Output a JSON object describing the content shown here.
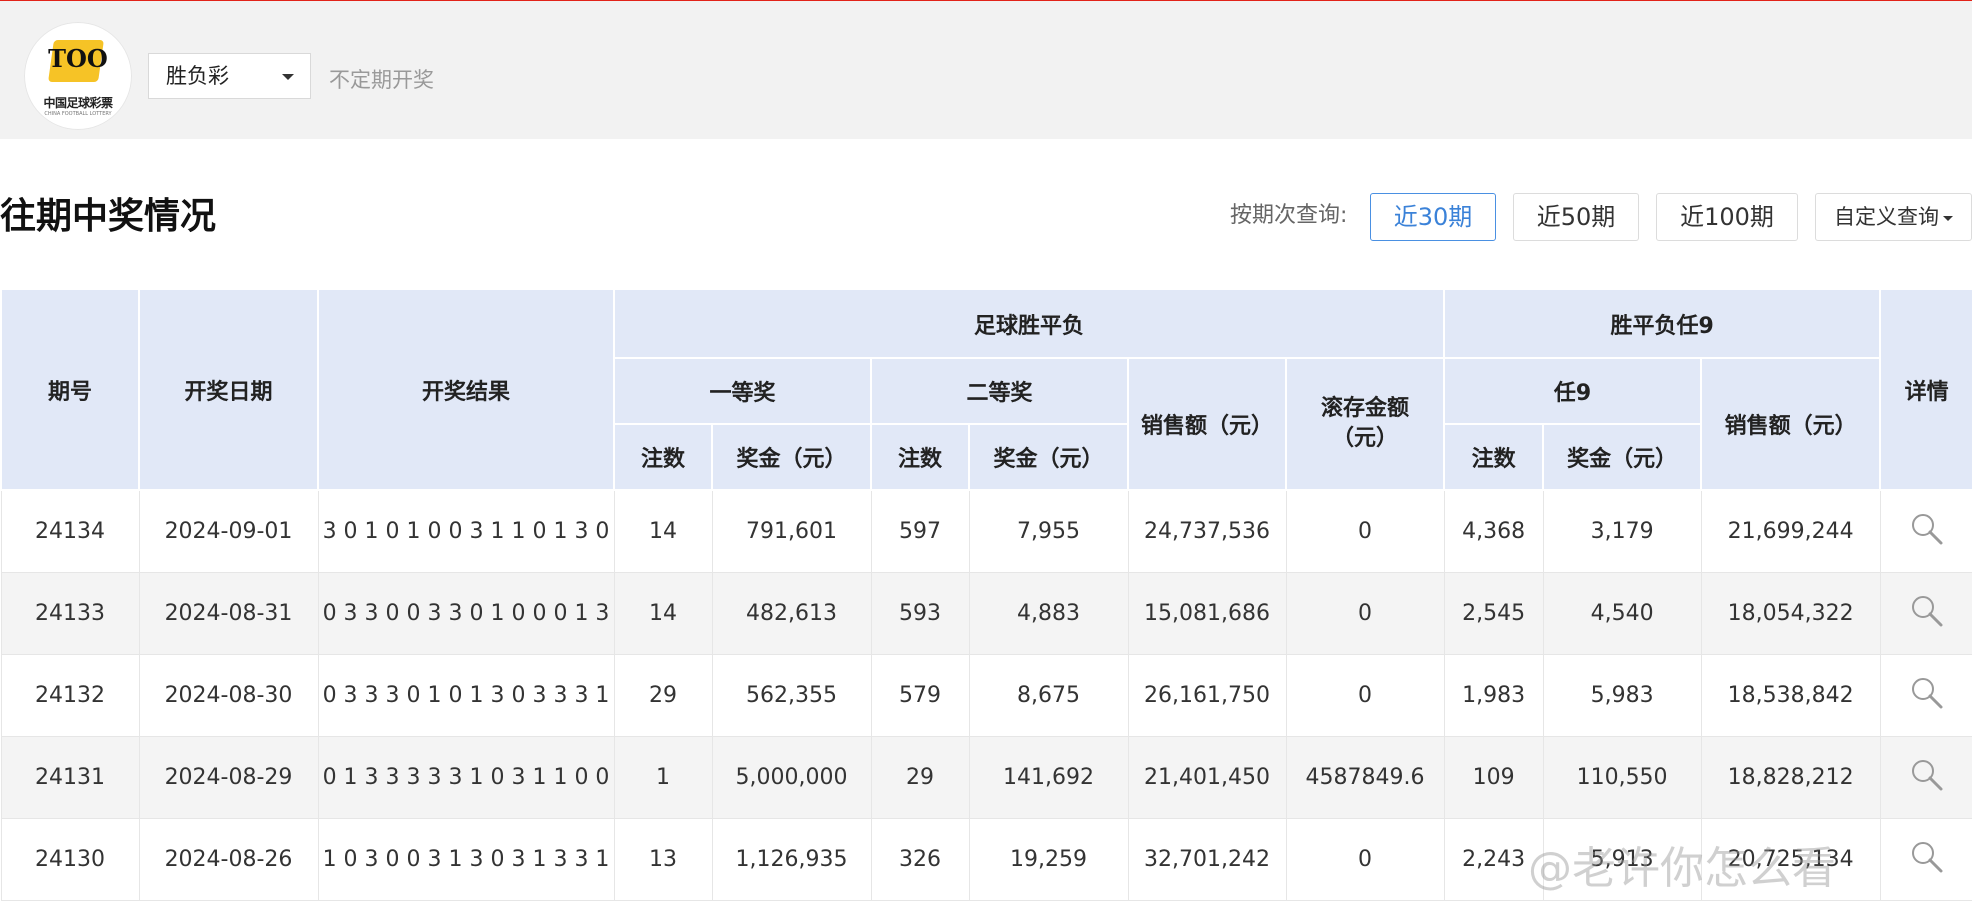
{
  "header": {
    "logo": {
      "cn": "中国足球彩票",
      "en": "CHINA FOOTBALL LOTTERY",
      "mark": "TOO"
    },
    "game_select": {
      "value": "胜负彩"
    },
    "draw_note": "不定期开奖"
  },
  "section": {
    "title": "往期中奖情况",
    "query_label": "按期次查询:",
    "buttons": [
      "近30期",
      "近50期",
      "近100期",
      "自定义查询"
    ]
  },
  "table": {
    "groups": {
      "football": "足球胜平负",
      "ren9": "胜平负任9"
    },
    "headers": {
      "issue": "期号",
      "date": "开奖日期",
      "result": "开奖结果",
      "first": "一等奖",
      "second": "二等奖",
      "sales": "销售额（元）",
      "rollover": "滚存金额（元）",
      "ren9": "任9",
      "ren9_sales": "销售额（元）",
      "detail": "详情",
      "count": "注数",
      "prize": "奖金（元）"
    },
    "rows": [
      {
        "issue": "24134",
        "date": "2024-09-01",
        "result": "3 0 1 0 1 0 0 3 1 1 0 1 3 0",
        "first_count": "14",
        "first_prize": "791,601",
        "second_count": "597",
        "second_prize": "7,955",
        "sales": "24,737,536",
        "rollover": "0",
        "r9_count": "4,368",
        "r9_prize": "3,179",
        "r9_sales": "21,699,244"
      },
      {
        "issue": "24133",
        "date": "2024-08-31",
        "result": "0 3 3 0 0 3 3 0 1 0 0 0 1 3",
        "first_count": "14",
        "first_prize": "482,613",
        "second_count": "593",
        "second_prize": "4,883",
        "sales": "15,081,686",
        "rollover": "0",
        "r9_count": "2,545",
        "r9_prize": "4,540",
        "r9_sales": "18,054,322"
      },
      {
        "issue": "24132",
        "date": "2024-08-30",
        "result": "0 3 3 3 0 1 0 1 3 0 3 3 3 1",
        "first_count": "29",
        "first_prize": "562,355",
        "second_count": "579",
        "second_prize": "8,675",
        "sales": "26,161,750",
        "rollover": "0",
        "r9_count": "1,983",
        "r9_prize": "5,983",
        "r9_sales": "18,538,842"
      },
      {
        "issue": "24131",
        "date": "2024-08-29",
        "result": "0 1 3 3 3 3 3 1 0 3 1 1 0 0",
        "first_count": "1",
        "first_prize": "5,000,000",
        "second_count": "29",
        "second_prize": "141,692",
        "sales": "21,401,450",
        "rollover": "4587849.6",
        "r9_count": "109",
        "r9_prize": "110,550",
        "r9_sales": "18,828,212"
      },
      {
        "issue": "24130",
        "date": "2024-08-26",
        "result": "1 0 3 0 0 3 1 3 0 3 1 3 3 1",
        "first_count": "13",
        "first_prize": "1,126,935",
        "second_count": "326",
        "second_prize": "19,259",
        "sales": "32,701,242",
        "rollover": "0",
        "r9_count": "2,243",
        "r9_prize": "5,913",
        "r9_sales": "20,725,134"
      }
    ]
  },
  "watermark": "@老许你怎么看",
  "icons": {
    "detail": "magnifier-icon",
    "dropdown": "caret-down-icon"
  },
  "colors": {
    "accent": "#3b82d8",
    "header_bg": "#e1e8f7",
    "topbar_red": "#e2231a"
  }
}
